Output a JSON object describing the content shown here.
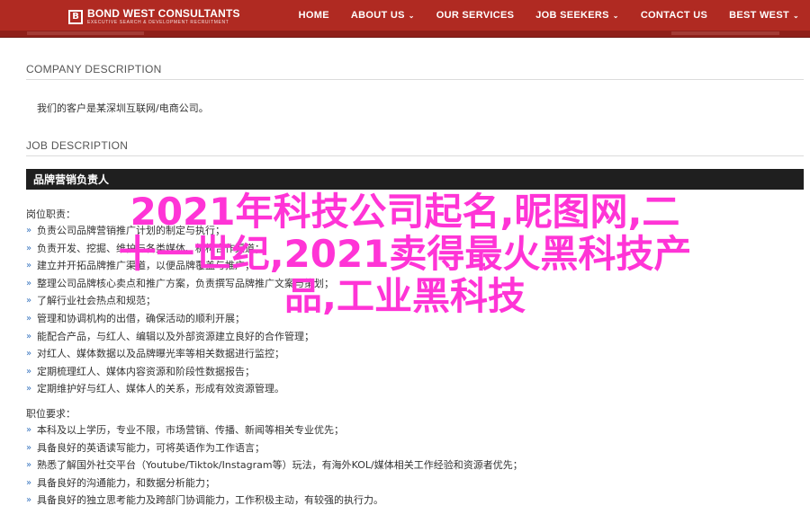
{
  "brand": {
    "name": "BOND WEST CONSULTANTS",
    "tagline": "EXECUTIVE SEARCH & DEVELOPMENT RECRUITMENT"
  },
  "nav": [
    {
      "label": "HOME",
      "dropdown": false
    },
    {
      "label": "ABOUT US",
      "dropdown": true
    },
    {
      "label": "OUR SERVICES",
      "dropdown": false
    },
    {
      "label": "JOB SEEKERS",
      "dropdown": true
    },
    {
      "label": "CONTACT US",
      "dropdown": false
    },
    {
      "label": "BEST WEST",
      "dropdown": true
    }
  ],
  "company": {
    "title": "COMPANY DESCRIPTION",
    "text": "我们的客户是某深圳互联网/电商公司。"
  },
  "job": {
    "title": "JOB DESCRIPTION",
    "header": "品牌营销负责人",
    "duties_label": "岗位职责：",
    "duties": [
      "负责公司品牌营销推广计划的制定与执行；",
      "负责开发、挖掘、维护与各类媒体、机构合作渠道；",
      "建立并开拓品牌推广渠道，以便品牌覆盖与推广；",
      "整理公司品牌核心卖点和推广方案，负责撰写品牌推广文案与策划；",
      "了解行业社会热点和规范；",
      "管理和协调机构的出借，确保活动的顺利开展；",
      "能配合产品，与红人、编辑以及外部资源建立良好的合作管理；",
      "对红人、媒体数据以及品牌曝光率等相关数据进行监控；",
      "定期梳理红人、媒体内容资源和阶段性数据报告；",
      "定期维护好与红人、媒体人的关系，形成有效资源管理。"
    ],
    "req_label": "职位要求：",
    "requirements": [
      "本科及以上学历，专业不限，市场营销、传播、新闻等相关专业优先；",
      "具备良好的英语读写能力，可将英语作为工作语言；",
      "熟悉了解国外社交平台（Youtube/Tiktok/Instagram等）玩法，有海外KOL/媒体相关工作经验和资源者优先；",
      "具备良好的沟通能力，和数据分析能力；",
      "具备良好的独立思考能力及跨部门协调能力，工作积极主动，有较强的执行力。"
    ]
  },
  "overlay": {
    "line1": "2021年科技公司起名,昵图网,二",
    "line2": "十一世纪,2021卖得最火黑科技产",
    "line3": "品,工业黑科技"
  },
  "colors": {
    "nav_bg": "#b02a22",
    "job_header_bg": "#1f1f1f",
    "bullet": "#3a76c0",
    "overlay_text": "#ff34d6"
  },
  "icons": {
    "bullet": "chevron-right-icon",
    "caret": "caret-down-icon"
  }
}
